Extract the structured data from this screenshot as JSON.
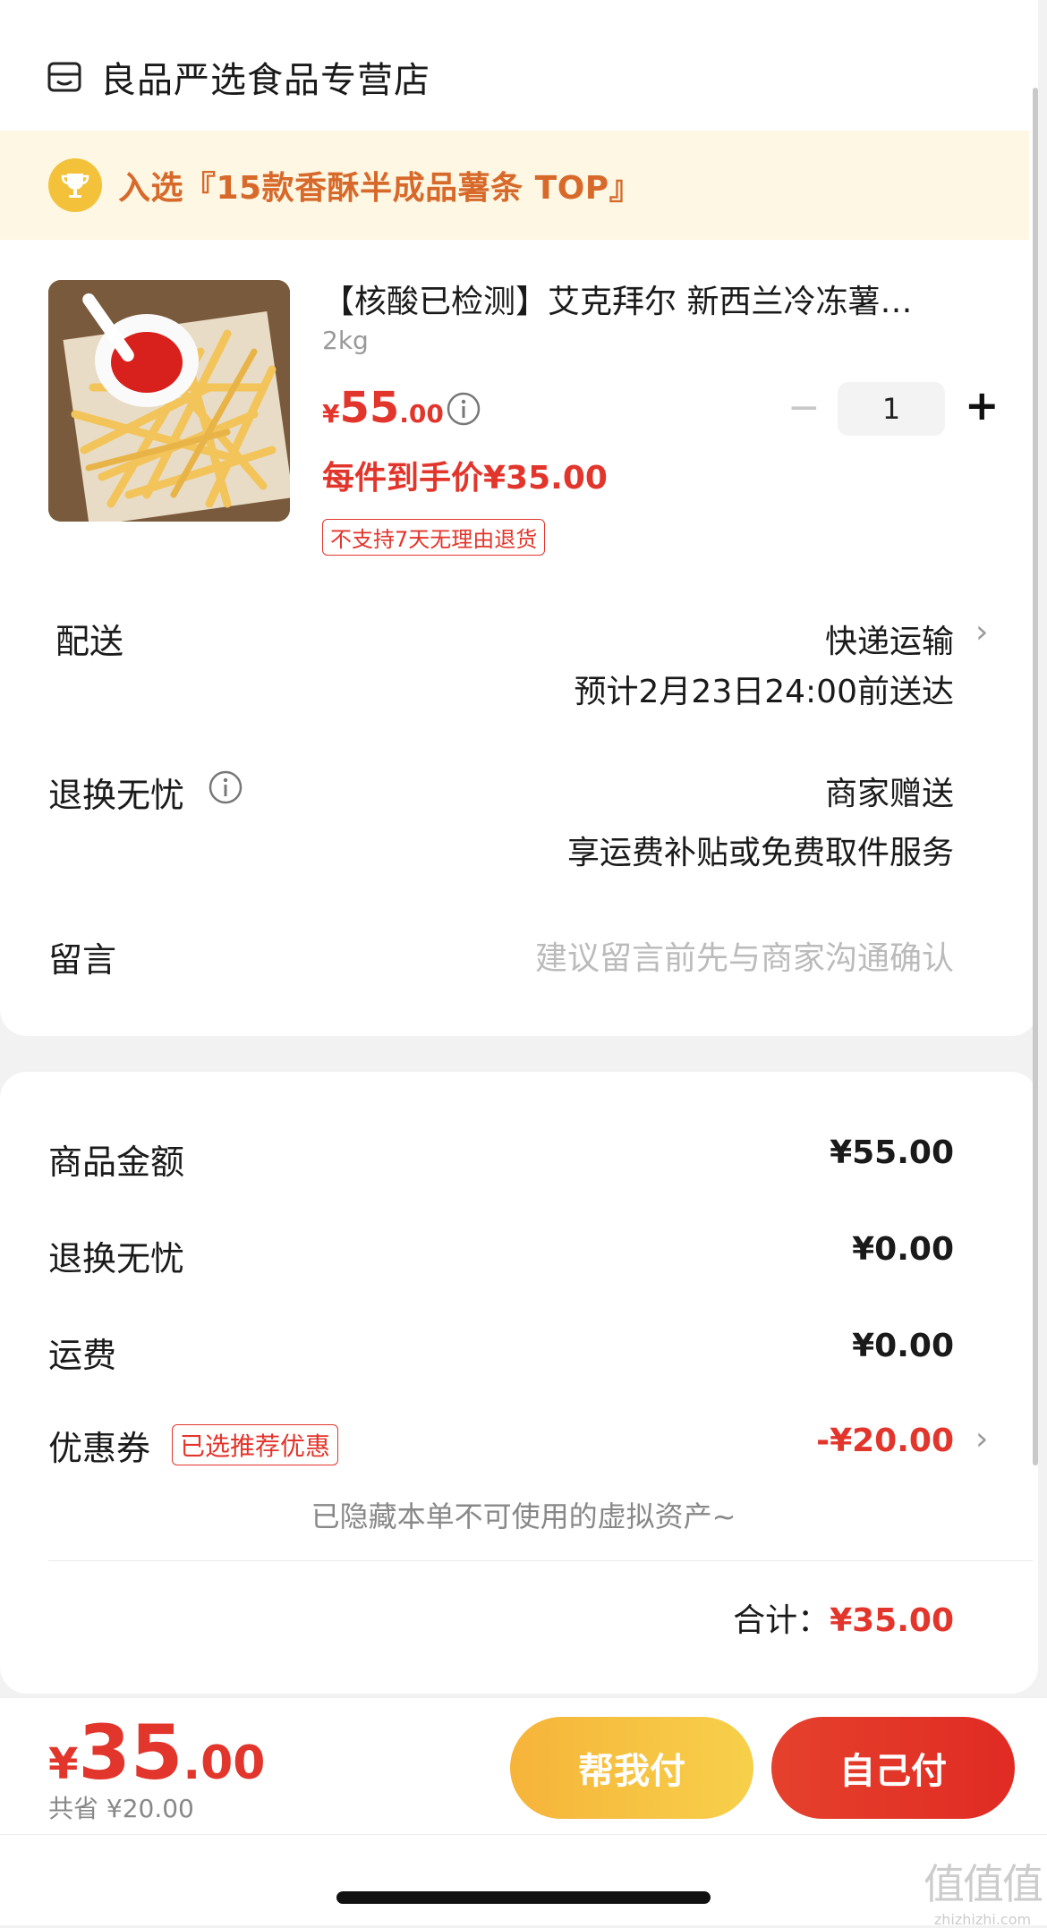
{
  "store": {
    "name": "良品严选食品专营店",
    "icon": "shop-icon"
  },
  "rank_banner": {
    "text": "入选『15款香酥半成品薯条 TOP』",
    "icon": "trophy-icon"
  },
  "product": {
    "title": "【核酸已检测】艾克拜尔 新西兰冷冻薯…",
    "spec": "2kg",
    "price": {
      "symbol": "¥",
      "integer": "55",
      "decimal": ".00"
    },
    "unit_price": "每件到手价¥35.00",
    "return_tag": "不支持7天无理由退货",
    "quantity": "1",
    "minus": "−",
    "plus": "+"
  },
  "delivery": {
    "label": "配送",
    "method": "快递运输",
    "eta": "预计2月23日24:00前送达"
  },
  "worry_free": {
    "label": "退换无忧",
    "value": "商家赠送",
    "desc": "享运费补贴或免费取件服务"
  },
  "message": {
    "label": "留言",
    "placeholder": "建议留言前先与商家沟通确认"
  },
  "summary": {
    "goods_label": "商品金额",
    "goods_value": "¥55.00",
    "worry_label": "退换无忧",
    "worry_value": "¥0.00",
    "shipping_label": "运费",
    "shipping_value": "¥0.00",
    "coupon_label": "优惠券",
    "coupon_tag": "已选推荐优惠",
    "coupon_value": "-¥20.00",
    "hidden_note": "已隐藏本单不可使用的虚拟资产~",
    "total_label": "合计：",
    "total_value": "¥35.00"
  },
  "footer": {
    "total_symbol": "¥",
    "total_int": "35",
    "total_dec": ".00",
    "saved": "共省 ¥20.00",
    "help_pay": "帮我付",
    "self_pay": "自己付"
  },
  "watermark": {
    "cn": "值值值",
    "en": "zhizhizhi.com"
  },
  "colors": {
    "accent": "#e2352b",
    "banner_bg": "#fdf7e3",
    "banner_text": "#d7692b",
    "help_btn": "#f6b43a"
  }
}
